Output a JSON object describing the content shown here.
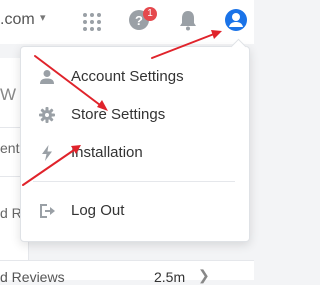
{
  "topbar": {
    "domain_text": ".com",
    "caret": "▾",
    "help_badge_count": "1"
  },
  "background": {
    "letter": "W C",
    "row1": "ent",
    "row2": "d Re",
    "bottom_label": "d Reviews",
    "bottom_value": "2.5m"
  },
  "menu": {
    "items": [
      {
        "label": "Account Settings",
        "icon": "user-icon"
      },
      {
        "label": "Store Settings",
        "icon": "gear-icon"
      },
      {
        "label": "Installation",
        "icon": "bolt-icon"
      },
      {
        "label": "Log Out",
        "icon": "logout-icon"
      }
    ]
  },
  "colors": {
    "accent": "#1a73e8",
    "icon_grey": "#9aa0a6",
    "badge": "#e5484d",
    "annotation": "#e0232b"
  }
}
